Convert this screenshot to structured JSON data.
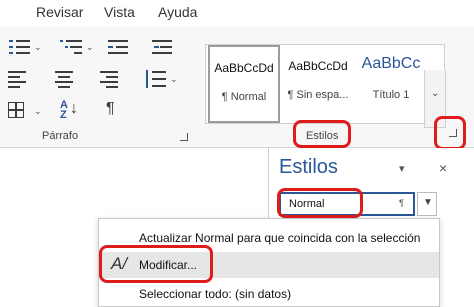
{
  "menu": {
    "items": [
      "Revisar",
      "Vista",
      "Ayuda"
    ]
  },
  "ribbon": {
    "paragraph_group_label": "Párrafo",
    "styles_group_label": "Estilos",
    "style_gallery": [
      {
        "sample": "AaBbCcDd",
        "name": "¶ Normal"
      },
      {
        "sample": "AaBbCcDd",
        "name": "¶ Sin espa..."
      },
      {
        "sample": "AaBbCc",
        "name": "Título 1"
      }
    ]
  },
  "styles_pane": {
    "title": "Estilos",
    "selected_style": "Normal",
    "selected_style_mark": "¶"
  },
  "context_menu": {
    "items": [
      "Actualizar Normal para que coincida con la selección",
      "Modificar...",
      "Seleccionar todo: (sin datos)"
    ]
  },
  "colors": {
    "highlight": "#e01b1b",
    "accent": "#2b5797"
  }
}
